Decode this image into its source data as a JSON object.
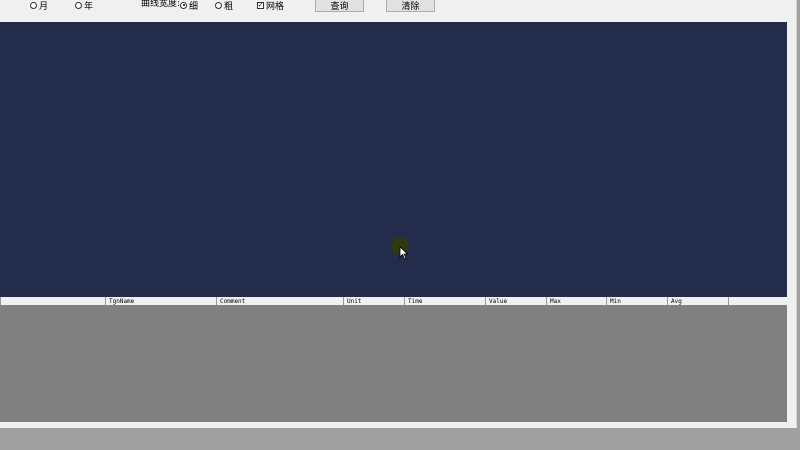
{
  "toolbar": {
    "period_month": "月",
    "period_year": "年",
    "line_width_label": "曲线宽度:",
    "width_thin": "细",
    "width_thick": "粗",
    "grid_label": "网格",
    "grid_checked": true,
    "width_selected": "thin",
    "query_label": "查询",
    "clear_label": "清除"
  },
  "table": {
    "columns": [
      "TgnName",
      "Comment",
      "Unit",
      "Time",
      "Value",
      "Max",
      "Min",
      "Avg"
    ]
  },
  "colors": {
    "chart_background": "#232c4b",
    "grid_background": "#808080",
    "window_background": "#f0f0f0"
  }
}
